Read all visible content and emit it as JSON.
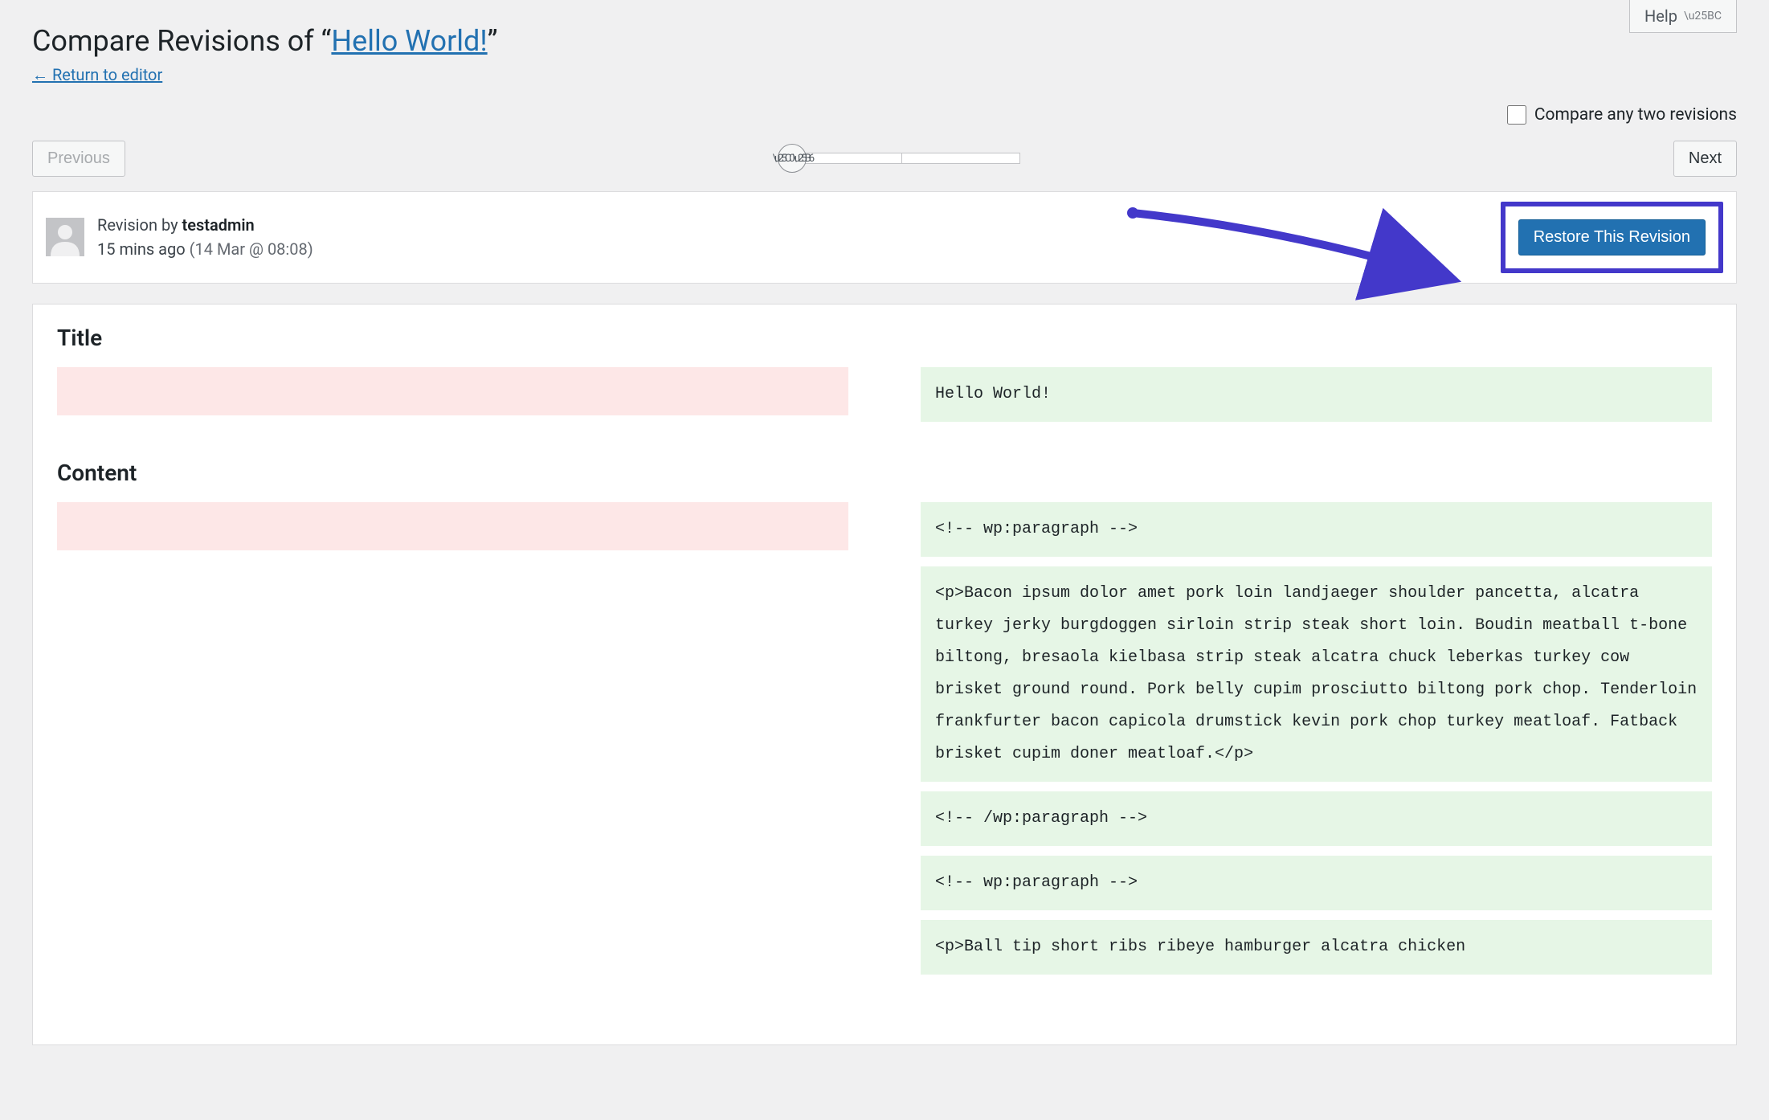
{
  "help_label": "Help",
  "page_title_prefix": "Compare Revisions of “",
  "page_title_link": "Hello World!",
  "page_title_suffix": "”",
  "return_link": "← Return to editor",
  "compare_any_label": "Compare any two revisions",
  "previous_label": "Previous",
  "next_label": "Next",
  "revision_by_label": "Revision by ",
  "revision_user": "testadmin",
  "revision_time": "15 mins ago ",
  "revision_when": "(14 Mar @ 08:08)",
  "restore_label": "Restore This Revision",
  "sections": {
    "title": {
      "heading": "Title",
      "removed_blocks": [
        ""
      ],
      "added_blocks": [
        "Hello World!"
      ]
    },
    "content": {
      "heading": "Content",
      "removed_blocks": [
        ""
      ],
      "added_blocks": [
        "<!-- wp:paragraph -->",
        "<p>Bacon ipsum dolor amet pork loin landjaeger shoulder pancetta, alcatra turkey jerky burgdoggen sirloin strip steak short loin. Boudin meatball t-bone biltong, bresaola kielbasa strip steak alcatra chuck leberkas turkey cow brisket ground round. Pork belly cupim prosciutto biltong pork chop. Tenderloin frankfurter bacon capicola drumstick kevin pork chop turkey meatloaf. Fatback brisket cupim doner meatloaf.</p>",
        "<!-- /wp:paragraph -->",
        "<!-- wp:paragraph -->",
        "<p>Ball tip short ribs ribeye hamburger alcatra chicken"
      ]
    }
  }
}
